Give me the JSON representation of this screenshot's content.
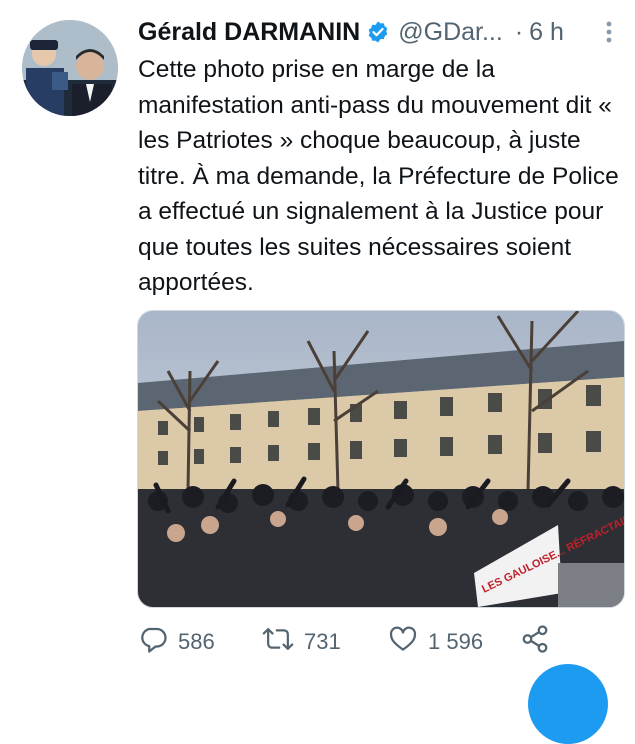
{
  "tweet": {
    "author_name": "Gérald DARMANIN",
    "handle": "@GDar...",
    "separator": "·",
    "time": "6 h",
    "text": "Cette photo prise en marge de la manifestation anti-pass du mouvement dit « les Patriotes » choque beaucoup, à juste titre. À ma demande, la Préfecture de Police a effectué un signalement à la Justice pour que toutes les suites nécessaires soient apportées.",
    "media": {
      "banner_text": "LES GAULOISE... RÉFRACTAIRES..."
    }
  },
  "actions": {
    "replies": "586",
    "retweets": "731",
    "likes": "1 596"
  },
  "icons": {
    "verified": "verified-badge-icon",
    "more": "more-vertical-icon",
    "reply": "reply-icon",
    "retweet": "retweet-icon",
    "like": "heart-icon",
    "share": "share-icon"
  },
  "colors": {
    "accent": "#1d9bf0",
    "text": "#0f1419",
    "secondary": "#536471"
  }
}
